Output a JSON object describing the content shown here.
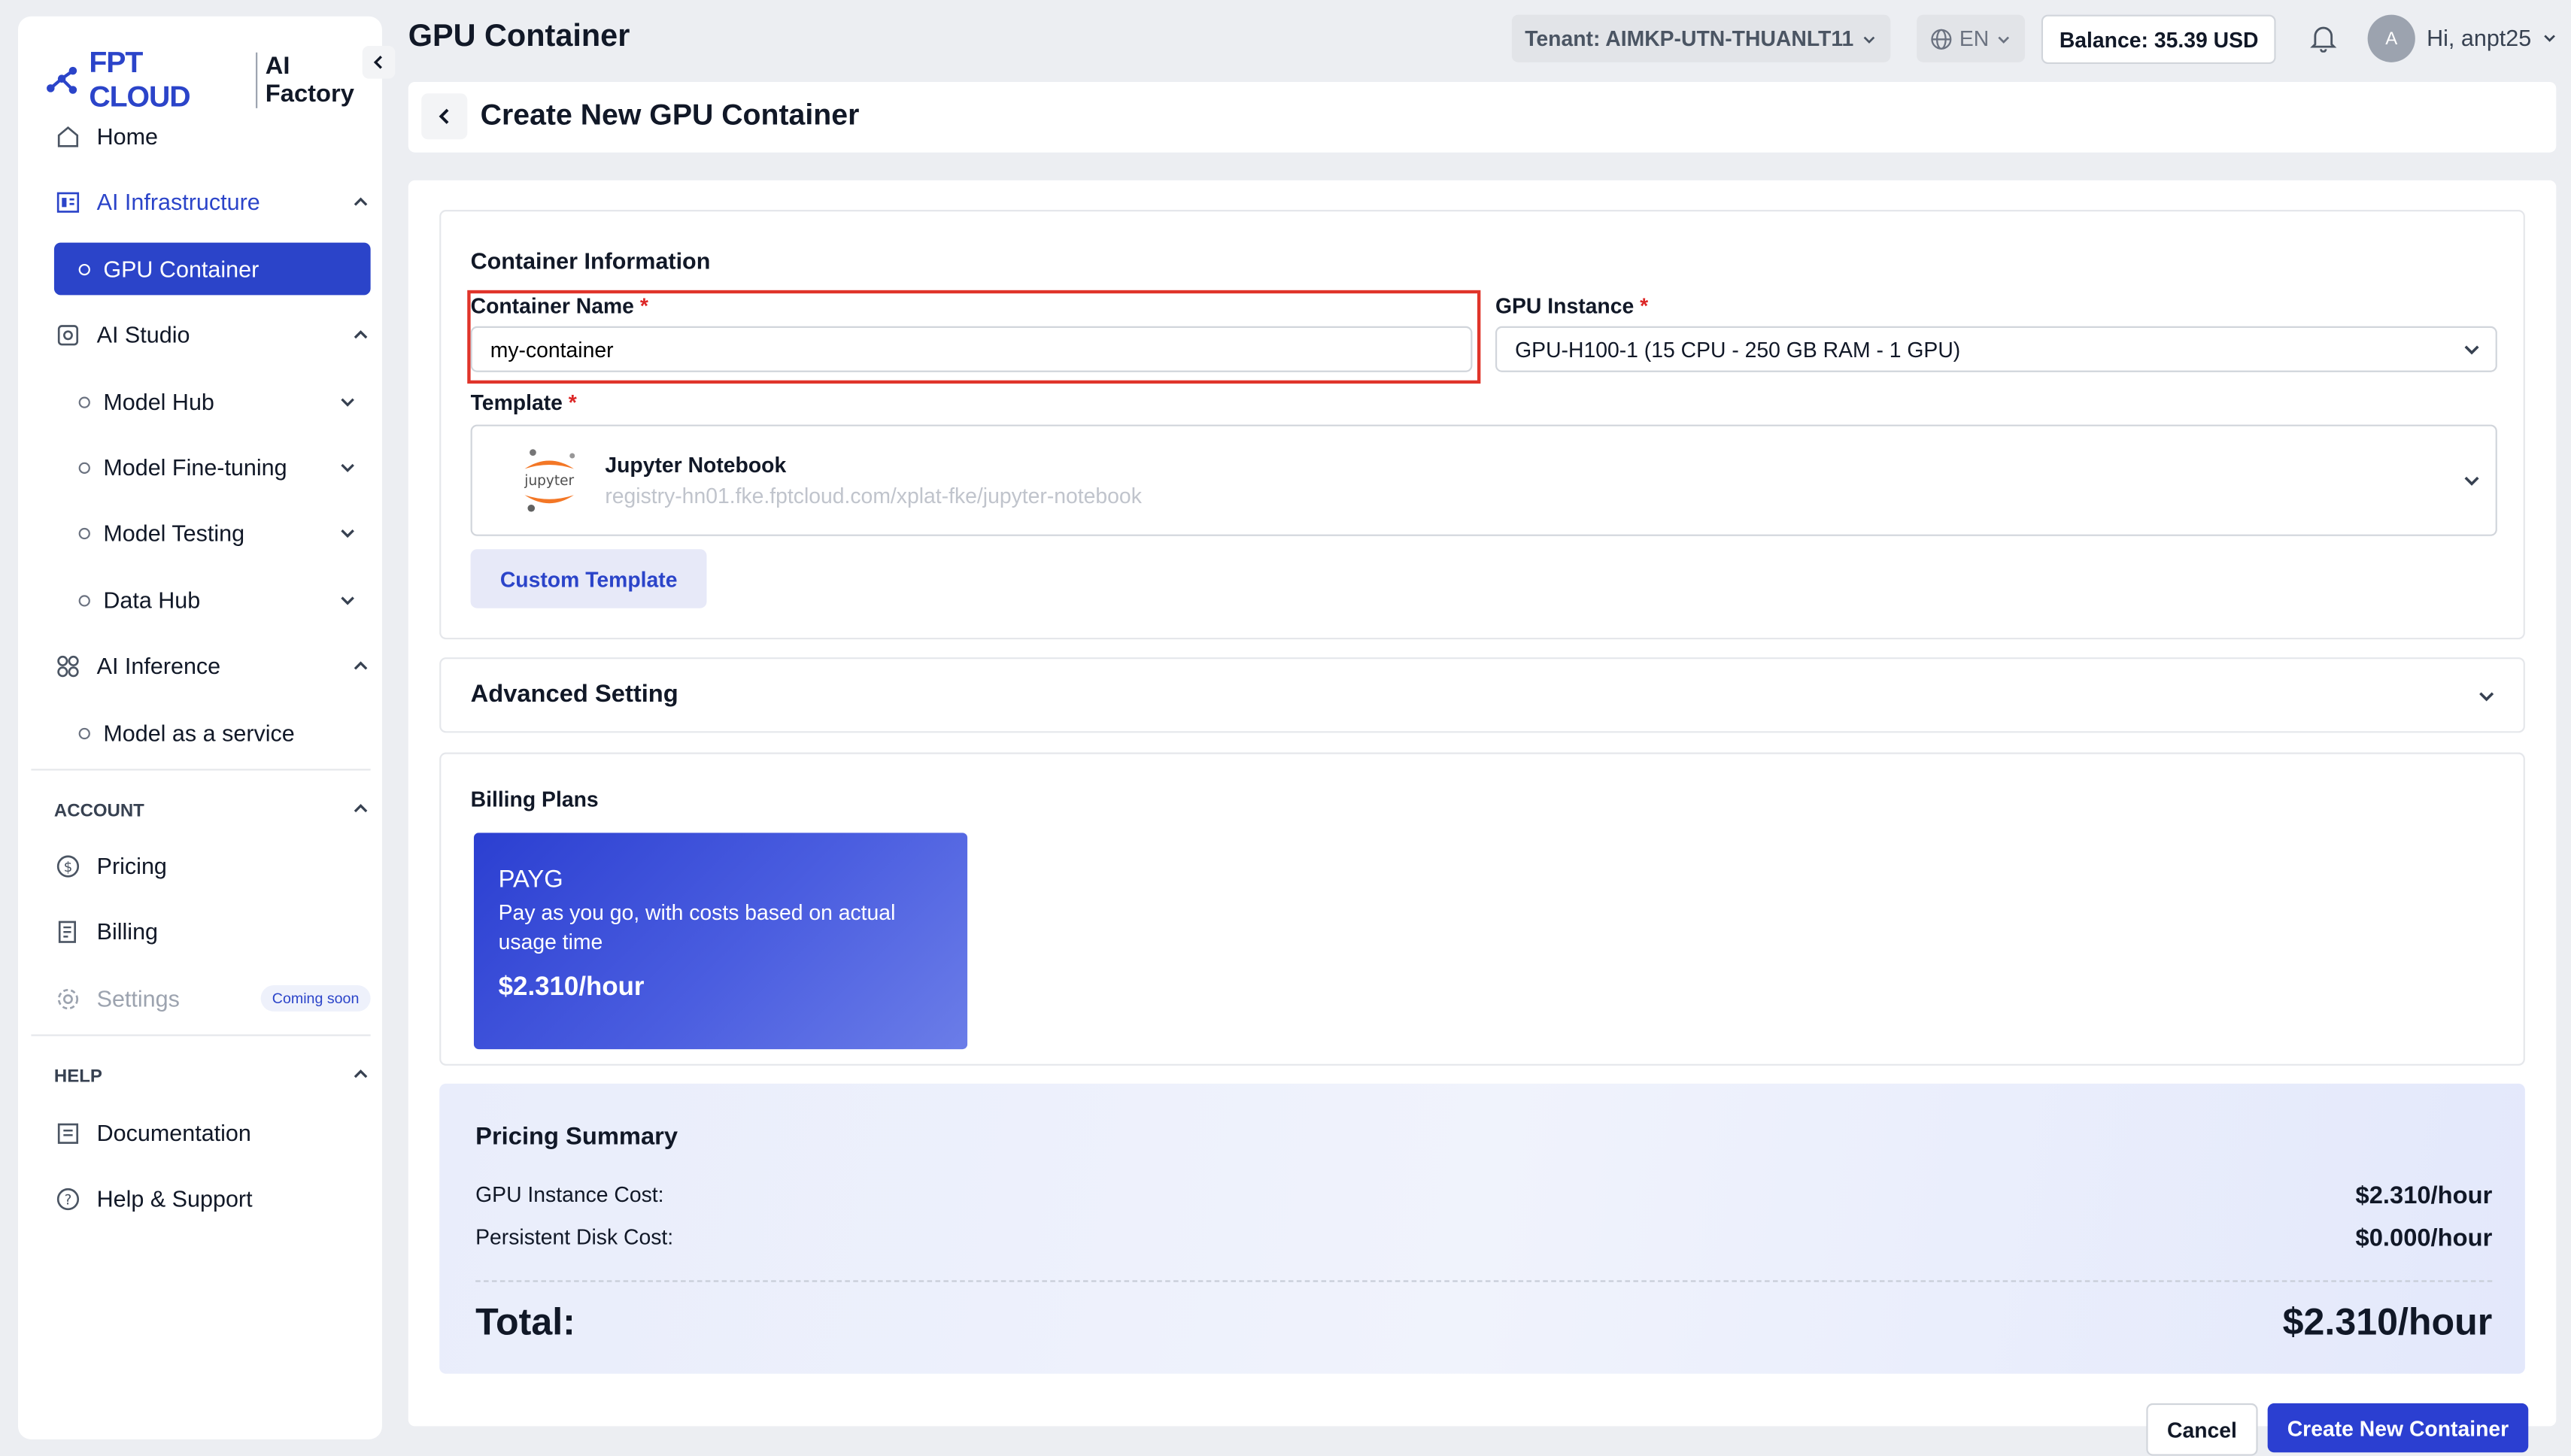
{
  "brand": {
    "logo_text": "FPT CLOUD",
    "product": "AI Factory"
  },
  "sidebar": {
    "items": [
      {
        "label": "Home",
        "icon": "home-icon"
      },
      {
        "label": "AI Infrastructure",
        "icon": "infrastructure-icon",
        "expanded": true
      },
      {
        "label": "GPU Container",
        "active": true
      },
      {
        "label": "AI Studio",
        "icon": "studio-icon",
        "expanded": true
      },
      {
        "label": "Model Hub"
      },
      {
        "label": "Model Fine-tuning"
      },
      {
        "label": "Model Testing"
      },
      {
        "label": "Data Hub"
      },
      {
        "label": "AI Inference",
        "icon": "inference-icon",
        "expanded": true
      },
      {
        "label": "Model as a service"
      }
    ],
    "account_title": "ACCOUNT",
    "account": [
      {
        "label": "Pricing",
        "icon": "dollar-icon"
      },
      {
        "label": "Billing",
        "icon": "billing-icon"
      },
      {
        "label": "Settings",
        "icon": "gear-icon",
        "badge": "Coming soon",
        "disabled": true
      }
    ],
    "help_title": "HELP",
    "help": [
      {
        "label": "Documentation",
        "icon": "document-icon"
      },
      {
        "label": "Help & Support",
        "icon": "help-icon"
      }
    ]
  },
  "topbar": {
    "title": "GPU Container",
    "tenant": "Tenant: AIMKP-UTN-THUANLT11",
    "language": "EN",
    "balance": "Balance: 35.39 USD",
    "avatar_initial": "A",
    "greeting": "Hi, anpt25"
  },
  "page": {
    "title": "Create New GPU Container"
  },
  "container_info": {
    "title": "Container Information",
    "name_label": "Container Name",
    "name_value": "my-container",
    "gpu_label": "GPU Instance",
    "gpu_value": "GPU-H100-1 (15 CPU - 250 GB RAM - 1 GPU)",
    "template_label": "Template",
    "template_name": "Jupyter Notebook",
    "template_logo_text": "jupyter",
    "template_url": "registry-hn01.fke.fptcloud.com/xplat-fke/jupyter-notebook",
    "custom_template_label": "Custom Template",
    "required_mark": "*"
  },
  "advanced": {
    "title": "Advanced Setting"
  },
  "billing": {
    "title": "Billing Plans",
    "plan_name": "PAYG",
    "plan_desc": "Pay as you go, with costs based on actual usage time",
    "plan_price": "$2.310/hour"
  },
  "summary": {
    "title": "Pricing Summary",
    "gpu_cost_label": "GPU Instance Cost:",
    "gpu_cost_value": "$2.310/hour",
    "disk_cost_label": "Persistent Disk Cost:",
    "disk_cost_value": "$0.000/hour",
    "total_label": "Total:",
    "total_value": "$2.310/hour"
  },
  "actions": {
    "cancel": "Cancel",
    "create": "Create New Container"
  },
  "colors": {
    "primary": "#2b44c9",
    "highlight": "#e0342a",
    "required": "#dc2626"
  }
}
